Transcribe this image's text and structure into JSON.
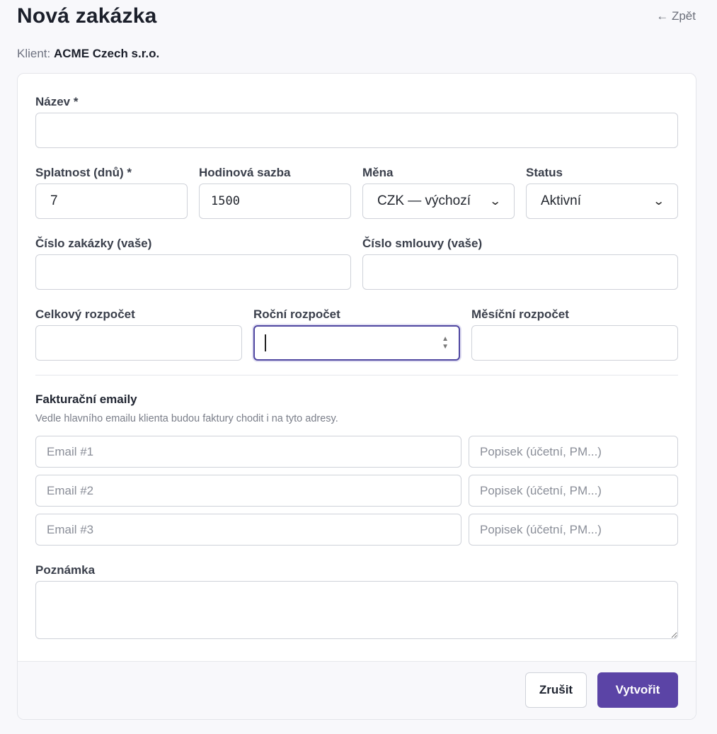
{
  "header": {
    "title": "Nová zakázka",
    "back_label": "← Zpět"
  },
  "client": {
    "prefix": "Klient:",
    "name": "ACME Czech s.r.o."
  },
  "form": {
    "name": {
      "label": "Název *",
      "value": ""
    },
    "due_days": {
      "label": "Splatnost (dnů) *",
      "value": "7"
    },
    "hourly_rate": {
      "label": "Hodinová sazba",
      "value": "1500"
    },
    "currency": {
      "label": "Měna",
      "selected": "CZK — výchozí"
    },
    "status": {
      "label": "Status",
      "selected": "Aktivní"
    },
    "order_number": {
      "label": "Číslo zakázky (vaše)",
      "value": ""
    },
    "contract_number": {
      "label": "Číslo smlouvy (vaše)",
      "value": ""
    },
    "total_budget": {
      "label": "Celkový rozpočet",
      "value": ""
    },
    "yearly_budget": {
      "label": "Roční rozpočet",
      "value": ""
    },
    "monthly_budget": {
      "label": "Měsíční rozpočet",
      "value": ""
    }
  },
  "billing_emails": {
    "title": "Fakturační emaily",
    "hint": "Vedle hlavního emailu klienta budou faktury chodit i na tyto adresy.",
    "rows": [
      {
        "email_placeholder": "Email #1",
        "note_placeholder": "Popisek (účetní, PM...)"
      },
      {
        "email_placeholder": "Email #2",
        "note_placeholder": "Popisek (účetní, PM...)"
      },
      {
        "email_placeholder": "Email #3",
        "note_placeholder": "Popisek (účetní, PM...)"
      }
    ]
  },
  "note": {
    "label": "Poznámka",
    "value": ""
  },
  "actions": {
    "cancel_label": "Zrušit",
    "create_label": "Vytvořit"
  },
  "colors": {
    "primary": "#5b44a6",
    "focus_border": "#4f46a0"
  },
  "icons": {
    "select_chevron": "chevron-down-icon",
    "number_spinner": "spinner-arrows-icon"
  }
}
